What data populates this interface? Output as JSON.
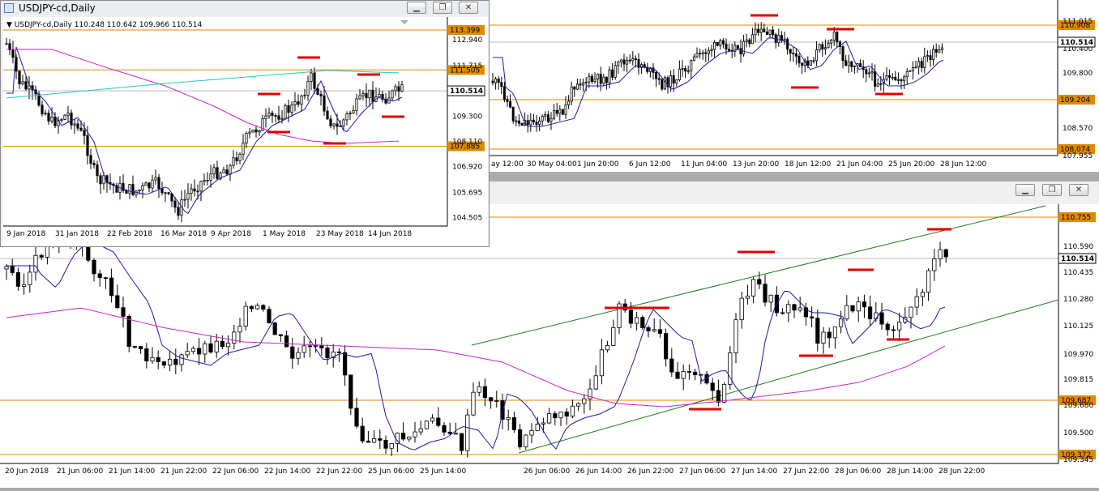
{
  "small_window": {
    "title": "USDJPY-cd,Daily",
    "header_label": "▼ USDJPY-cd,Daily  110.248 110.642 109.966 110.514",
    "price_ticks": [
      "112.940",
      "111.715",
      "109.300",
      "108.110",
      "106.920",
      "105.695",
      "104.505"
    ],
    "level_labels": [
      {
        "text": "113.399",
        "price": 113.399
      },
      {
        "text": "111.505",
        "price": 111.505
      },
      {
        "text": "107.885",
        "price": 107.885
      }
    ],
    "current_label": "110.514",
    "date_ticks": [
      "9 Jan 2018",
      "31 Jan 2018",
      "22 Feb 2018",
      "16 Mar 2018",
      "9 Apr 2018",
      "1 May 2018",
      "23 May 2018",
      "14 Jun 2018"
    ],
    "buttons": {
      "minimize": "▁",
      "maximize": "❐",
      "close": "✕"
    }
  },
  "top_chart": {
    "price_ticks": [
      "111.015",
      "110.400",
      "109.800",
      "108.570",
      "107.955"
    ],
    "level_labels": [
      {
        "text": "110.908",
        "price": 110.908
      },
      {
        "text": "109.204",
        "price": 109.204
      },
      {
        "text": "108.074",
        "price": 108.074
      }
    ],
    "current_label": "110.514",
    "date_ticks": [
      "ay 12:00",
      "30 May 04:00",
      "1 Jun 20:00",
      "6 Jun 12:00",
      "11 Jun 04:00",
      "13 Jun 20:00",
      "18 Jun 12:00",
      "21 Jun 04:00",
      "25 Jun 20:00",
      "28 Jun 12:00"
    ]
  },
  "bottom_window": {
    "buttons": {
      "minimize": "▁",
      "maximize": "❐",
      "close": "✕"
    },
    "price_ticks": [
      "110.590",
      "110.435",
      "110.280",
      "110.125",
      "109.970",
      "109.815",
      "109.680",
      "109.500",
      "109.345"
    ],
    "level_labels": [
      {
        "text": "110.755",
        "price": 110.755
      },
      {
        "text": "109.687",
        "price": 109.687
      },
      {
        "text": "109.372",
        "price": 109.372
      }
    ],
    "current_label": "110.514",
    "date_ticks": [
      "20 Jun 2018",
      "21 Jun 06:00",
      "21 Jun 14:00",
      "21 Jun 22:00",
      "22 Jun 06:00",
      "22 Jun 14:00",
      "22 Jun 22:00",
      "25 Jun 06:00",
      "25 Jun 14:00",
      "26 Jun 06:00",
      "26 Jun 14:00",
      "26 Jun 22:00",
      "27 Jun 06:00",
      "27 Jun 14:00",
      "27 Jun 22:00",
      "28 Jun 06:00",
      "28 Jun 14:00",
      "28 Jun 22:00"
    ]
  },
  "colors": {
    "level_line": "#e08a00",
    "ma_fast": "#1a1aa8",
    "ma_slow": "#cc22cc",
    "ma_cyan": "#22c8c8",
    "channel": "#1f7a1f",
    "marker": "#e00000"
  },
  "chart_data": [
    {
      "type": "candlestick",
      "symbol": "USDJPY-cd",
      "timeframe": "Daily",
      "ohlc_last": {
        "open": 110.248,
        "high": 110.642,
        "low": 109.966,
        "close": 110.514
      },
      "ylim": [
        104.505,
        113.399
      ],
      "horizontal_levels": [
        113.399,
        111.505,
        107.885
      ],
      "x_range": [
        "9 Jan 2018",
        "14 Jun 2018"
      ]
    },
    {
      "type": "candlestick",
      "ylim": [
        107.955,
        111.015
      ],
      "horizontal_levels": [
        110.908,
        109.204,
        108.074
      ],
      "current": 110.514
    },
    {
      "type": "candlestick",
      "ylim": [
        109.345,
        110.755
      ],
      "horizontal_levels": [
        110.755,
        109.687,
        109.372
      ],
      "current": 110.514
    }
  ]
}
